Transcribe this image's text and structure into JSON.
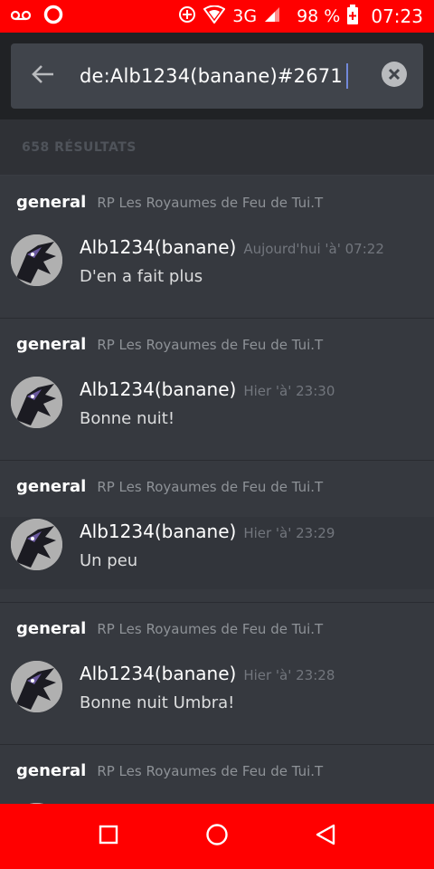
{
  "status_bar": {
    "network": "3G",
    "battery": "98 %",
    "time": "07:23"
  },
  "search": {
    "query": "de:Alb1234(banane)#2671"
  },
  "results_count": "658 RÉSULTATS",
  "results": [
    {
      "channel": "general",
      "guild": "RP Les Royaumes de Feu de Tui.T",
      "author": "Alb1234(banane)",
      "timestamp": "Aujourd'hui 'à' 07:22",
      "text": "D'en a fait plus"
    },
    {
      "channel": "general",
      "guild": "RP Les Royaumes de Feu de Tui.T",
      "author": "Alb1234(banane)",
      "timestamp": "Hier 'à' 23:30",
      "text": "Bonne nuit!"
    },
    {
      "channel": "general",
      "guild": "RP Les Royaumes de Feu de Tui.T",
      "author": "Alb1234(banane)",
      "timestamp": "Hier 'à' 23:29",
      "text": "Un peu"
    },
    {
      "channel": "general",
      "guild": "RP Les Royaumes de Feu de Tui.T",
      "author": "Alb1234(banane)",
      "timestamp": "Hier 'à' 23:28",
      "text": "Bonne nuit Umbra!"
    },
    {
      "channel": "general",
      "guild": "RP Les Royaumes de Feu de Tui.T",
      "author": "",
      "timestamp": "",
      "text": ""
    }
  ],
  "colors": {
    "status_bar": "#ff0000",
    "background": "#36393f",
    "header": "#202225",
    "search_box": "#40444b",
    "caret": "#7289da"
  },
  "icons": {
    "back": "arrow-left-icon",
    "clear": "clear-circle-icon",
    "nav_recent": "square-icon",
    "nav_home": "circle-icon",
    "nav_back": "triangle-icon"
  }
}
